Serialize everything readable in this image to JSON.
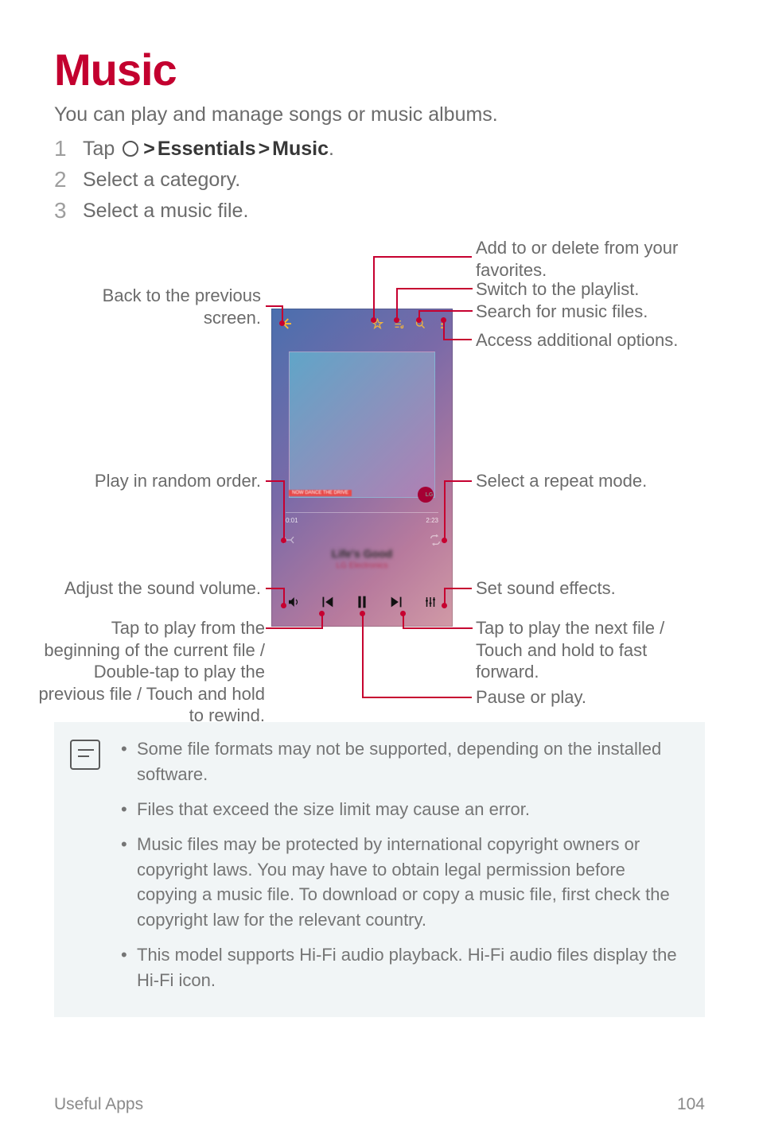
{
  "title": "Music",
  "intro": "You can play and manage songs or music albums.",
  "steps": {
    "step1": {
      "pre": "Tap ",
      "path1": "Essentials",
      "path2": "Music",
      "post": "."
    },
    "step2": "Select a category.",
    "step3": "Select a music file."
  },
  "labels": {
    "back_screen": "Back to the previous screen.",
    "favorites": "Add to or delete from your favorites.",
    "playlist": "Switch to the playlist.",
    "search": "Search for music files.",
    "options": "Access additional options.",
    "repeat": "Select a repeat mode.",
    "shuffle": "Play in random order.",
    "volume": "Adjust the sound volume.",
    "effects": "Set sound effects.",
    "prev": "Tap to play from the beginning of the current file / Double-tap to play the previous file / Touch and hold to rewind.",
    "next": "Tap to play the next file / Touch and hold to fast forward.",
    "pause": "Pause or play."
  },
  "phone": {
    "time0": "0:01",
    "time1": "2:23",
    "song": "Life's Good",
    "artist": "LG Electronics",
    "nowplaying": "NOW  DANCE  THE DRIVE"
  },
  "notes": [
    "Some file formats may not be supported, depending on the installed software.",
    "Files that exceed the size limit may cause an error.",
    "Music files may be protected by international copyright owners or copyright laws. You may have to obtain legal permission before copying a music file. To download or copy a music file, first check the copyright law for the relevant country.",
    "This model supports Hi-Fi audio playback. Hi-Fi audio files display the Hi-Fi icon."
  ],
  "footer": {
    "section": "Useful Apps",
    "page": "104"
  }
}
